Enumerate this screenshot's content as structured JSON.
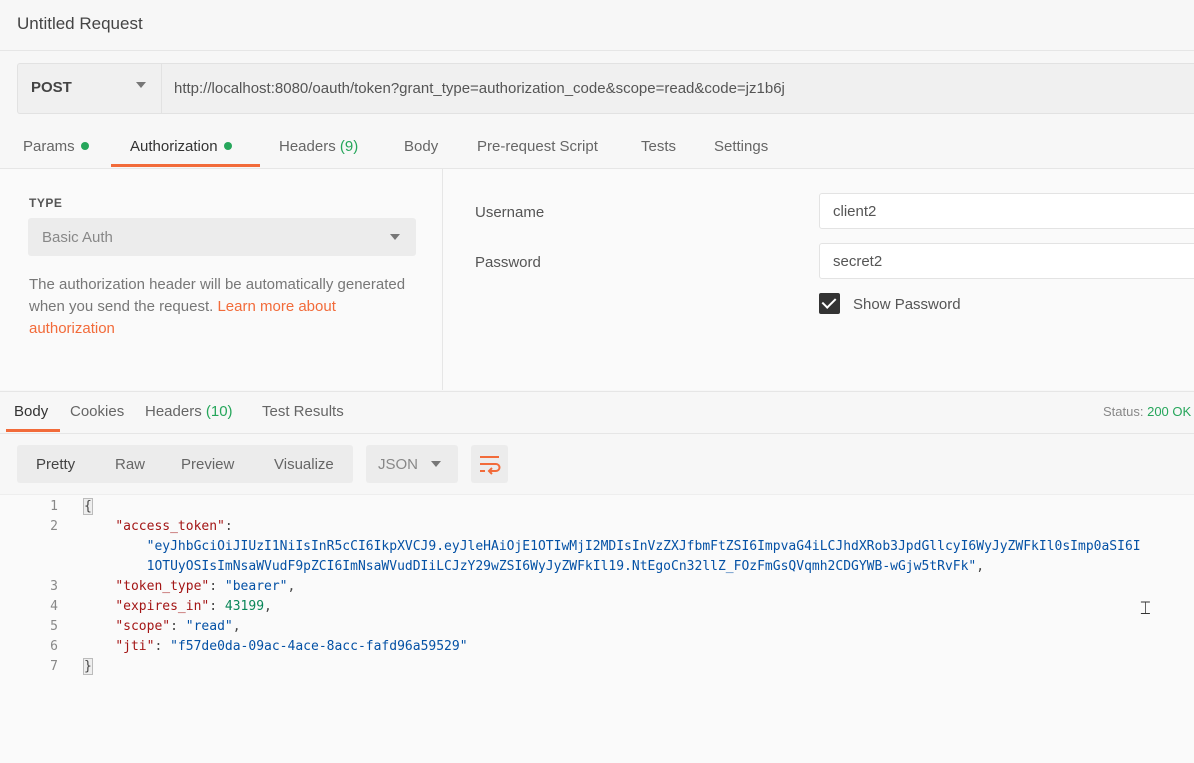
{
  "window": {
    "title": "Untitled Request"
  },
  "request": {
    "method": "POST",
    "url": "http://localhost:8080/oauth/token?grant_type=authorization_code&scope=read&code=jz1b6j"
  },
  "request_tabs": {
    "params": "Params",
    "authorization": "Authorization",
    "headers": "Headers",
    "headers_count": "(9)",
    "body": "Body",
    "prerequest": "Pre-request Script",
    "tests": "Tests",
    "settings": "Settings"
  },
  "auth": {
    "type_label": "TYPE",
    "type_value": "Basic Auth",
    "description": "The authorization header will be automatically generated when you send the request. ",
    "learn_more": "Learn more about authorization",
    "username_label": "Username",
    "username_value": "client2",
    "password_label": "Password",
    "password_value": "secret2",
    "show_password_label": "Show Password",
    "show_password_checked": true
  },
  "response_tabs": {
    "body": "Body",
    "cookies": "Cookies",
    "headers": "Headers",
    "headers_count": "(10)",
    "test_results": "Test Results",
    "status_label": "Status:",
    "status_value": "200 OK"
  },
  "response_view": {
    "modes": [
      "Pretty",
      "Raw",
      "Preview",
      "Visualize"
    ],
    "format": "JSON"
  },
  "response_body": {
    "line_numbers": [
      "1",
      "2",
      "3",
      "4",
      "5",
      "6",
      "7"
    ],
    "open_brace": "{",
    "close_brace": "}",
    "access_token_key": "\"access_token\"",
    "access_token_line1": "\"eyJhbGciOiJIUzI1NiIsInR5cCI6IkpXVCJ9.eyJleHAiOjE1OTIwMjI2MDIsInVzZXJfbmFtZSI6ImpvaG4iLCJhdXRob3JpdGllcyI6WyJyZWFkIl0sImp0aSI6I",
    "access_token_line2": "1OTUyOSIsImNsaWVudF9pZCI6ImNsaWVudDIiLCJzY29wZSI6WyJyZWFkIl19.NtEgoCn32llZ_FOzFmGsQVqmh2CDGYWB-wGjw5tRvFk\"",
    "token_type_key": "\"token_type\"",
    "token_type_value": "\"bearer\"",
    "expires_in_key": "\"expires_in\"",
    "expires_in_value": "43199",
    "scope_key": "\"scope\"",
    "scope_value": "\"read\"",
    "jti_key": "\"jti\"",
    "jti_value": "\"f57de0da-09ac-4ace-8acc-fafd96a59529\""
  },
  "colors": {
    "accent": "#f26b3a",
    "status_green": "#26a65b"
  }
}
